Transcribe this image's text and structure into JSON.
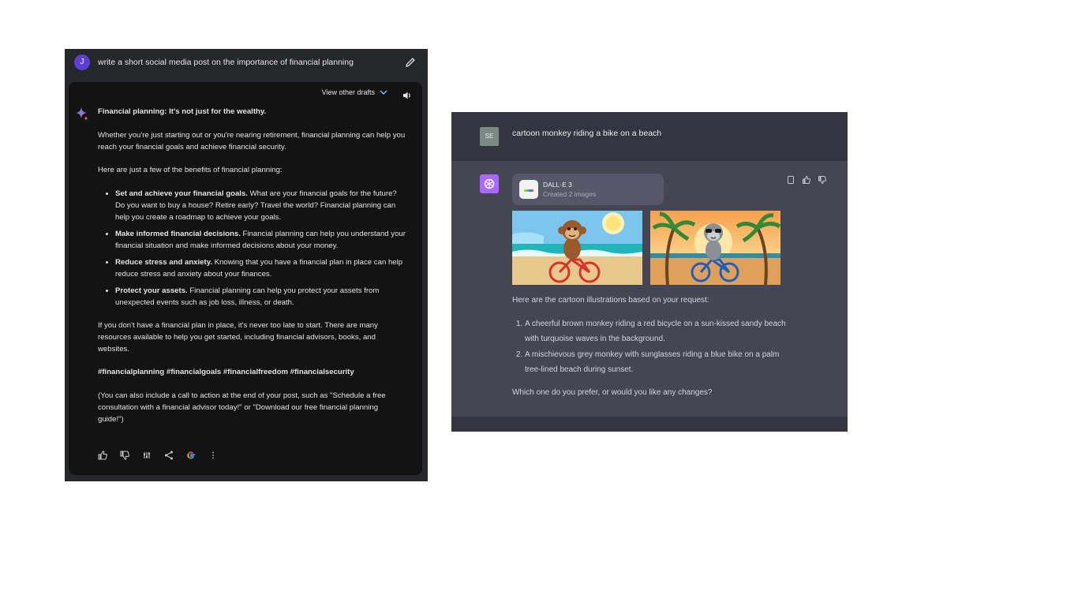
{
  "bard": {
    "user_avatar_letter": "J",
    "prompt": "write a short social media post on the importance of financial planning",
    "view_drafts_label": "View other drafts",
    "headline": "Financial planning: It's not just for the wealthy.",
    "intro": "Whether you're just starting out or you're nearing retirement, financial planning can help you reach your financial goals and achieve financial security.",
    "benefits_lead": "Here are just a few of the benefits of financial planning:",
    "benefits": [
      {
        "title": "Set and achieve your financial goals.",
        "text": "What are your financial goals for the future? Do you want to buy a house? Retire early? Travel the world? Financial planning can help you create a roadmap to achieve your goals."
      },
      {
        "title": "Make informed financial decisions.",
        "text": "Financial planning can help you understand your financial situation and make informed decisions about your money."
      },
      {
        "title": "Reduce stress and anxiety.",
        "text": "Knowing that you have a financial plan in place can help reduce stress and anxiety about your finances."
      },
      {
        "title": "Protect your assets.",
        "text": "Financial planning can help you protect your assets from unexpected events such as job loss, illness, or death."
      }
    ],
    "closing": "If you don't have a financial plan in place, it's never too late to start. There are many resources available to help you get started, including financial advisors, books, and websites.",
    "hashtags": "#financialplanning #financialgoals #financialfreedom #financialsecurity",
    "note": "(You can also include a call to action at the end of your post, such as \"Schedule a free consultation with a financial advisor today!\" or \"Download our free financial planning guide!\")",
    "icons": [
      "thumbs-up-icon",
      "thumbs-down-icon",
      "adjust-icon",
      "share-icon",
      "google-icon",
      "more-vert-icon"
    ]
  },
  "chatgpt": {
    "user_avatar": "SE",
    "user_message": "cartoon monkey riding a bike on a beach",
    "dalle_title": "DALL·E 3",
    "dalle_subtitle": "Created 2 images",
    "intro": "Here are the cartoon illustrations based on your request:",
    "items": [
      "A cheerful brown monkey riding a red bicycle on a sun-kissed sandy beach with turquoise waves in the background.",
      "A mischievous grey monkey with sunglasses riding a blue bike on a palm tree-lined beach during sunset."
    ],
    "question": "Which one do you prefer, or would you like any changes?",
    "icons": [
      "copy-icon",
      "thumbs-up-icon",
      "thumbs-down-icon"
    ]
  },
  "colors": {
    "bard_bg": "#26272a",
    "bard_card": "#131314",
    "gpt_bg": "#444654",
    "gpt_user_bg": "#343541",
    "gpt_accent": "#ab68ff"
  }
}
